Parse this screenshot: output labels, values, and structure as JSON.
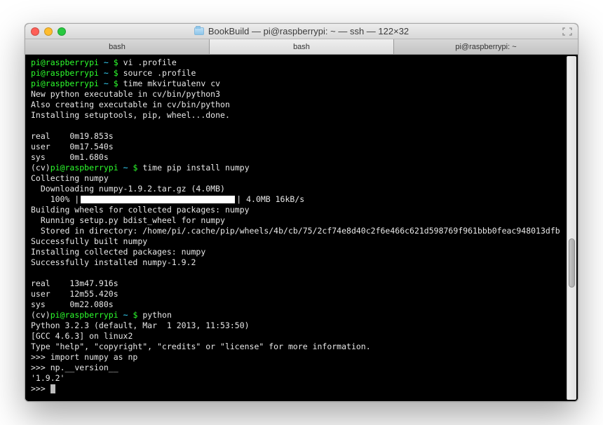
{
  "titlebar": {
    "title": "BookBuild — pi@raspberrypi: ~ — ssh — 122×32"
  },
  "tabs": [
    {
      "label": "bash",
      "active": false
    },
    {
      "label": "bash",
      "active": true
    },
    {
      "label": "pi@raspberrypi: ~",
      "active": false
    }
  ],
  "colors": {
    "prompt_user": "#2dff2d",
    "prompt_path": "#35d8ff",
    "terminal_bg": "#000000",
    "terminal_fg": "#e8e8e8"
  },
  "prompt": {
    "userhost": "pi@raspberrypi",
    "path": "~",
    "sep": "$",
    "venv": "(cv)"
  },
  "lines": {
    "cmd1": "vi .profile",
    "cmd2": "source .profile",
    "cmd3": "time mkvirtualenv cv",
    "out1": "New python executable in cv/bin/python3",
    "out2": "Also creating executable in cv/bin/python",
    "out3": "Installing setuptools, pip, wheel...done.",
    "time1_real": "real    0m19.853s",
    "time1_user": "user    0m17.540s",
    "time1_sys": "sys     0m1.680s",
    "cmd4": "time pip install numpy",
    "pip1": "Collecting numpy",
    "pip2": "  Downloading numpy-1.9.2.tar.gz (4.0MB)",
    "pip3_pct": "    100% |",
    "pip3_rest": "| 4.0MB 16kB/s",
    "pip4": "Building wheels for collected packages: numpy",
    "pip5": "  Running setup.py bdist_wheel for numpy",
    "pip6": "  Stored in directory: /home/pi/.cache/pip/wheels/4b/cb/75/2cf74e8d40c2f6e466c621d598769f961bbb0feac948013dfb",
    "pip7": "Successfully built numpy",
    "pip8": "Installing collected packages: numpy",
    "pip9": "Successfully installed numpy-1.9.2",
    "time2_real": "real    13m47.916s",
    "time2_user": "user    12m55.420s",
    "time2_sys": "sys     0m22.080s",
    "cmd5": "python",
    "py1": "Python 3.2.3 (default, Mar  1 2013, 11:53:50)",
    "py2": "[GCC 4.6.3] on linux2",
    "py3": "Type \"help\", \"copyright\", \"credits\" or \"license\" for more information.",
    "py_prompt": ">>>",
    "py_in1": "import numpy as np",
    "py_in2": "np.__version__",
    "py_out": "'1.9.2'"
  }
}
